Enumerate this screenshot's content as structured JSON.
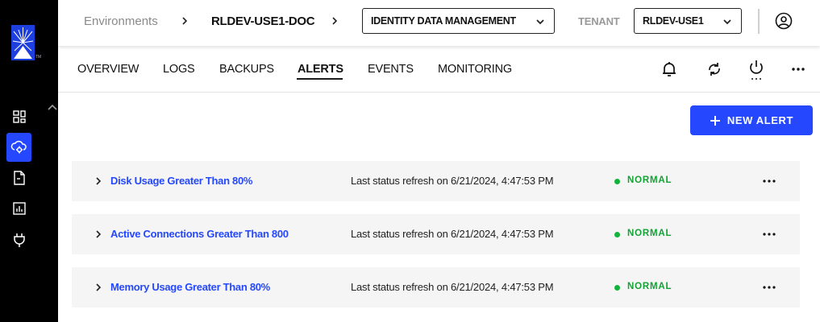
{
  "app": {
    "logo_tm": "TM"
  },
  "breadcrumb": {
    "root": "Environments",
    "environment": "RLDEV-USE1-DOC"
  },
  "header": {
    "product_select_value": "IDENTITY DATA MANAGEMENT",
    "tenant_label": "TENANT",
    "tenant_select_value": "RLDEV-USE1"
  },
  "tabs": [
    {
      "label": "OVERVIEW"
    },
    {
      "label": "LOGS"
    },
    {
      "label": "BACKUPS"
    },
    {
      "label": "ALERTS",
      "active": true
    },
    {
      "label": "EVENTS"
    },
    {
      "label": "MONITORING"
    }
  ],
  "toolbar": {
    "new_alert_label": "NEW ALERT"
  },
  "alerts": [
    {
      "name": "Disk Usage Greater Than 80%",
      "refresh": "Last status refresh on 6/21/2024, 4:47:53 PM",
      "status": "NORMAL"
    },
    {
      "name": "Active Connections Greater Than 800",
      "refresh": "Last status refresh on 6/21/2024, 4:47:53 PM",
      "status": "NORMAL"
    },
    {
      "name": "Memory Usage Greater Than 80%",
      "refresh": "Last status refresh on 6/21/2024, 4:47:53 PM",
      "status": "NORMAL"
    }
  ],
  "colors": {
    "accent": "#2548ff",
    "status_normal": "#12b33a",
    "sidebar_bg": "#000000"
  },
  "icons": [
    "dashboard-icon",
    "cloud-settings-icon",
    "document-icon",
    "report-icon",
    "plug-icon",
    "bell-icon",
    "sync-icon",
    "power-icon",
    "more-icon",
    "user-icon"
  ]
}
